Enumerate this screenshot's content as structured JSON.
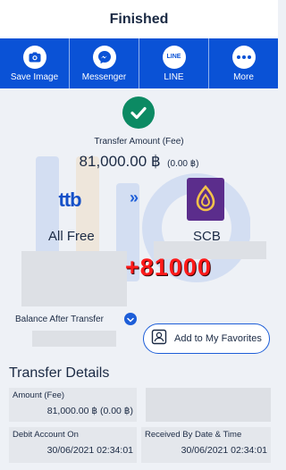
{
  "header": {
    "title": "Finished"
  },
  "share": [
    {
      "label": "Save Image",
      "icon": "camera-icon"
    },
    {
      "label": "Messenger",
      "icon": "messenger-icon"
    },
    {
      "label": "LINE",
      "icon": "line-icon",
      "icon_text": "LINE"
    },
    {
      "label": "More",
      "icon": "more-dots-icon"
    }
  ],
  "transfer": {
    "caption": "Transfer Amount (Fee)",
    "amount": "81,000.00 ฿",
    "fee": "(0.00 ฿)",
    "from_bank": "All Free",
    "to_bank": "SCB",
    "from_logo_text": "ttb",
    "arrow": "»"
  },
  "overlay_amount": "+81000",
  "balance_label": "Balance After Transfer",
  "favorites_label": "Add to My Favorites",
  "details": {
    "title": "Transfer Details",
    "amount_label": "Amount (Fee)",
    "amount_value": "81,000.00 ฿ (0.00 ฿)",
    "debit_label": "Debit Account On",
    "debit_value": "30/06/2021 02:34:01",
    "received_label": "Received By Date & Time",
    "received_value": "30/06/2021 02:34:01"
  },
  "colors": {
    "brand_blue": "#0a52d6",
    "success_green": "#0c8a63",
    "scb_purple": "#5b2d8c",
    "overlay_red": "#ff1a1a"
  }
}
